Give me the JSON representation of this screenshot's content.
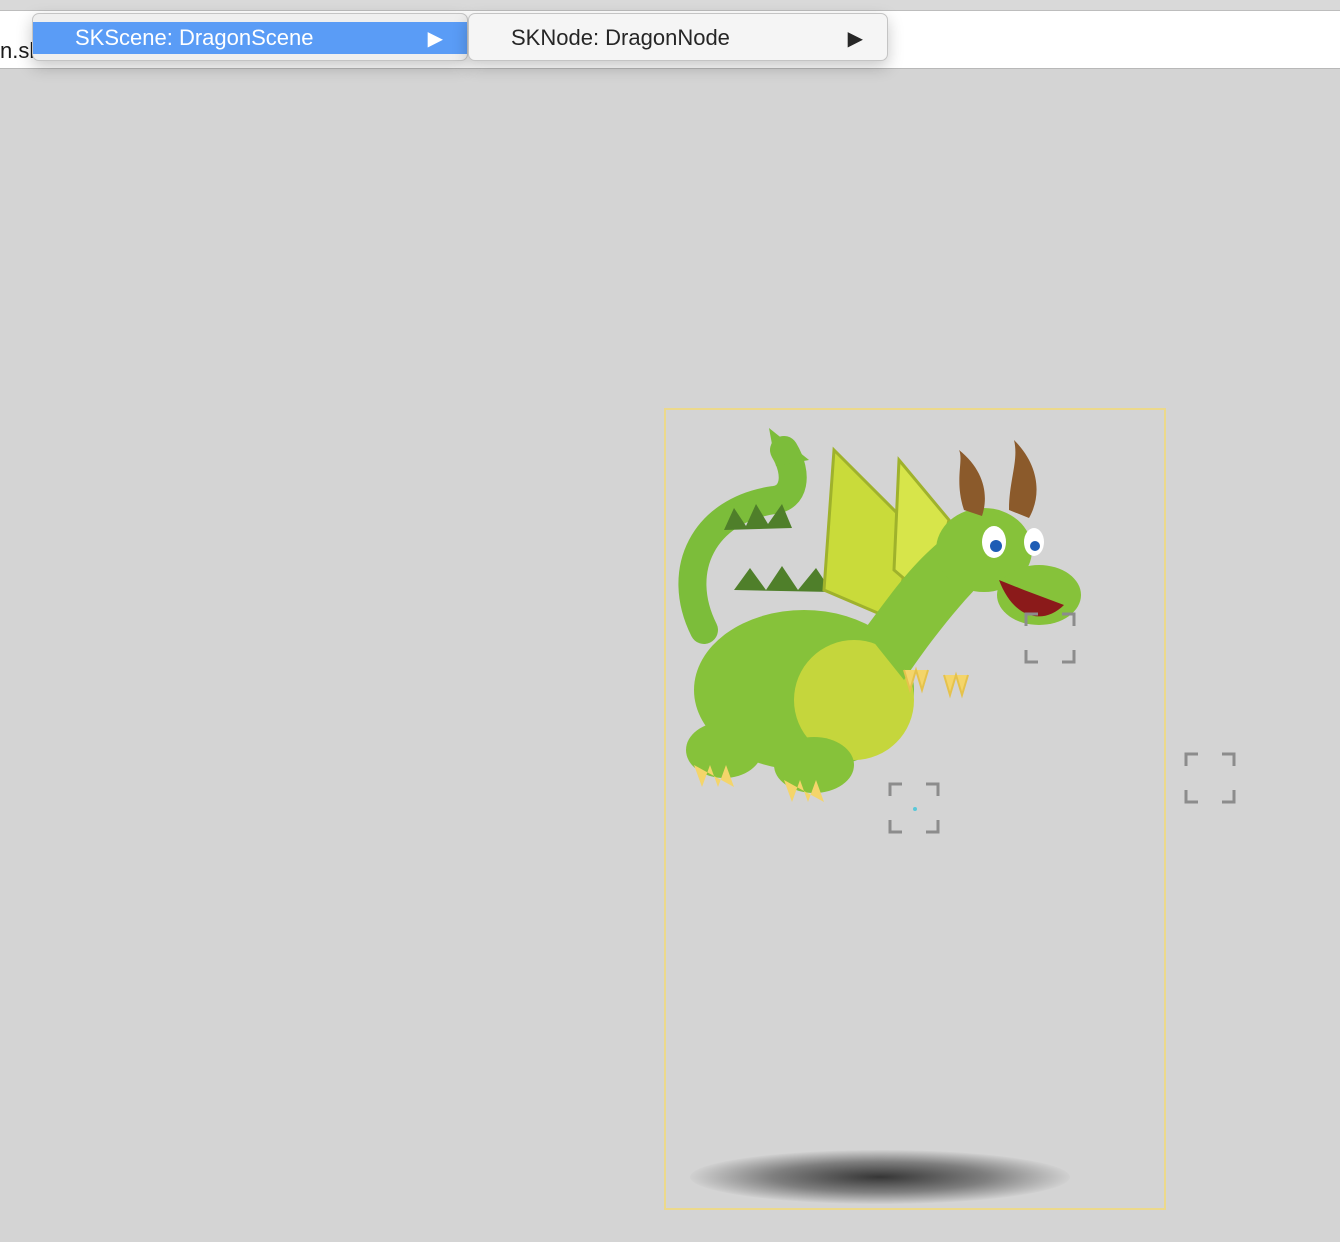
{
  "path_bar": {
    "file_fragment": "n.sk"
  },
  "menus": [
    {
      "label": "SKScene: DragonScene",
      "arrow": "▶",
      "selected": true
    },
    {
      "label": "SKNode: DragonNode",
      "arrow": "▶",
      "selected": false
    }
  ],
  "colors": {
    "selection": "#5a9cf6",
    "scene_frame": "#ecd98b",
    "canvas": "#d4d4d4"
  },
  "icons": {
    "submenu": "triangle-right-icon",
    "node_handle": "selection-corners-icon"
  }
}
